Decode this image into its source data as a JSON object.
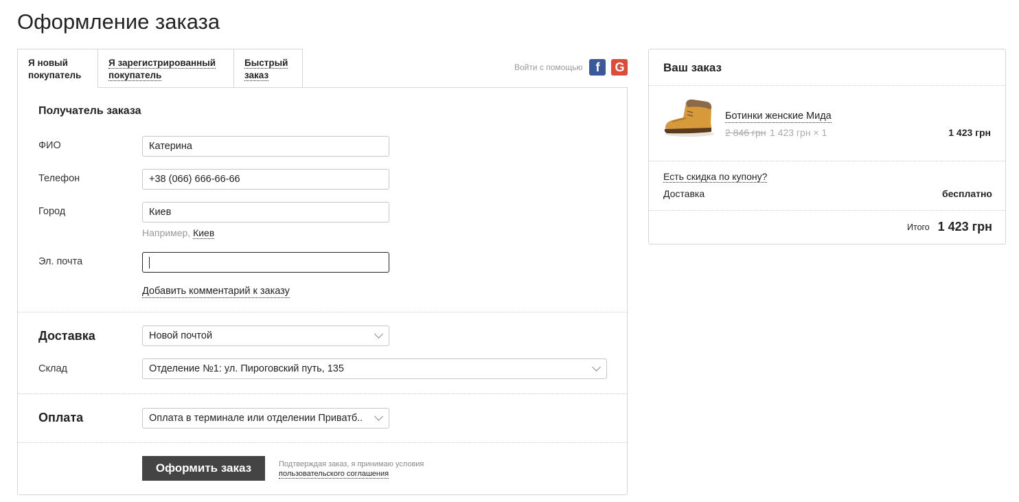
{
  "page": {
    "title": "Оформление заказа"
  },
  "tabs": [
    {
      "label_line1": "Я новый",
      "label_line2": "покупатель"
    },
    {
      "label_line1": "Я зарегистрированный",
      "label_line2": "покупатель"
    },
    {
      "label_line1": "Быстрый",
      "label_line2": "заказ"
    }
  ],
  "social": {
    "label": "Войти с помощью",
    "facebook_glyph": "f",
    "google_glyph": "G",
    "icons": [
      "facebook-icon",
      "google-icon"
    ]
  },
  "recipient": {
    "title": "Получатель заказа",
    "name_label": "ФИО",
    "name_value": "Катерина",
    "phone_label": "Телефон",
    "phone_value": "+38 (066) 666-66-66",
    "city_label": "Город",
    "city_value": "Киев",
    "city_hint_prefix": "Например,",
    "city_hint_link": "Киев",
    "email_label": "Эл. почта",
    "email_value": "",
    "comment_link": "Добавить комментарий к заказу"
  },
  "delivery": {
    "title": "Доставка",
    "method_value": "Новой почтой",
    "warehouse_label": "Склад",
    "warehouse_value": "Отделение №1: ул. Пироговский путь, 135"
  },
  "payment": {
    "title": "Оплата",
    "method_value": "Оплата в терминале или отделении Приватб.."
  },
  "submit": {
    "button_label": "Оформить заказ",
    "agree_text": "Подтверждая заказ, я принимаю условия",
    "agree_link": "пользовательского соглашения"
  },
  "summary": {
    "title": "Ваш заказ",
    "item": {
      "name": "Ботинки женские Мида",
      "old_price": "2 846 грн",
      "unit_price": "1 423 грн × 1",
      "line_total": "1 423 грн"
    },
    "coupon_link": "Есть скидка по купону?",
    "delivery_label": "Доставка",
    "delivery_value": "бесплатно",
    "total_label": "Итого",
    "total_value": "1 423 грн"
  },
  "colors": {
    "button_bg": "#444444",
    "facebook": "#3b5998",
    "google": "#dd4b39",
    "border": "#d4d4d4"
  }
}
